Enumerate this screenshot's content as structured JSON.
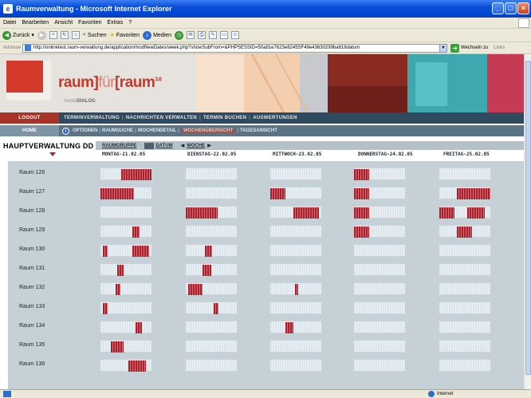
{
  "window": {
    "title": "Raumverwaltung - Microsoft Internet Explorer",
    "menu": [
      "Datei",
      "Bearbeiten",
      "Ansicht",
      "Favoriten",
      "Extras",
      "?"
    ],
    "toolbar": {
      "back": "Zurück",
      "search": "Suchen",
      "favorites": "Favoriten",
      "media": "Medien"
    },
    "address": {
      "label": "Adresse",
      "url": "http://onlinetest.raum-verwaltung.de/application/modNewDates/week.php?showSubFrom=&PHPSESSID=50a81e7623e8245SF49e43630299ba618datum",
      "go": "Wechseln zu",
      "links": "Links"
    },
    "status_zone": "Internet"
  },
  "brand": {
    "name_a": "raum]",
    "name_b": "für",
    "name_c": "[raum",
    "version": "3.6",
    "sub_a": "media",
    "sub_b": "DIALOG"
  },
  "nav1": {
    "logout": "LOGOUT",
    "items": [
      "TERMINVERWALTUNG",
      "NACHRICHTEN VERWALTEN",
      "TERMIN BUCHEN",
      "AUSWERTUNGEN"
    ]
  },
  "nav2": {
    "home": "HOME",
    "items": [
      "OPTIONEN",
      "RAUMSUCHE",
      "WOCHENDETAIL",
      "WOCHENÜBERSICHT",
      "TAGESANSICHT"
    ],
    "active_index": 3
  },
  "view": {
    "location": "HAUPTVERWALTUNG DD",
    "raumgruppe": "RAUMGRUPPE",
    "datum": "DATUM",
    "woche": "WOCHE",
    "days": [
      "MONTAG-21.02.05",
      "DIENSTAG-22.02.05",
      "MITTWOCH-23.02.05",
      "DONNERSTAG-24.02.05",
      "FREITAG-25.02.05"
    ]
  },
  "rooms": [
    {
      "name": "Raum 126",
      "bookings": [
        [
          [
            0.4,
            1.0
          ]
        ],
        [],
        [],
        [
          [
            0.0,
            0.3
          ]
        ],
        []
      ]
    },
    {
      "name": "Raum 127",
      "bookings": [
        [
          [
            0.0,
            0.65
          ]
        ],
        [],
        [
          [
            0.0,
            0.3
          ]
        ],
        [
          [
            0.0,
            0.3
          ]
        ],
        [
          [
            0.35,
            1.0
          ]
        ]
      ]
    },
    {
      "name": "Raum 128",
      "bookings": [
        [],
        [
          [
            0.0,
            0.63
          ]
        ],
        [
          [
            0.45,
            0.95
          ]
        ],
        [
          [
            0.0,
            0.3
          ]
        ],
        [
          [
            0.0,
            0.3
          ],
          [
            0.55,
            0.9
          ]
        ]
      ]
    },
    {
      "name": "Raum 129",
      "bookings": [
        [
          [
            0.62,
            0.76
          ]
        ],
        [],
        [],
        [
          [
            0.0,
            0.3
          ]
        ],
        [
          [
            0.35,
            0.65
          ]
        ]
      ]
    },
    {
      "name": "Raum 130",
      "bookings": [
        [
          [
            0.05,
            0.15
          ],
          [
            0.62,
            0.95
          ]
        ],
        [
          [
            0.38,
            0.52
          ]
        ],
        [],
        [],
        []
      ]
    },
    {
      "name": "Raum 131",
      "bookings": [
        [
          [
            0.33,
            0.45
          ]
        ],
        [
          [
            0.33,
            0.5
          ]
        ],
        [],
        [],
        []
      ]
    },
    {
      "name": "Raum 132",
      "bookings": [
        [
          [
            0.3,
            0.4
          ]
        ],
        [
          [
            0.05,
            0.33
          ]
        ],
        [
          [
            0.48,
            0.55
          ]
        ],
        [],
        []
      ]
    },
    {
      "name": "Raum 133",
      "bookings": [
        [
          [
            0.05,
            0.15
          ]
        ],
        [
          [
            0.55,
            0.65
          ]
        ],
        [],
        [],
        []
      ]
    },
    {
      "name": "Raum 134",
      "bookings": [
        [
          [
            0.68,
            0.8
          ]
        ],
        [],
        [
          [
            0.3,
            0.45
          ]
        ],
        [],
        []
      ]
    },
    {
      "name": "Raum 135",
      "bookings": [
        [
          [
            0.2,
            0.45
          ]
        ],
        [],
        [],
        [],
        []
      ]
    },
    {
      "name": "Raum 136",
      "bookings": [
        [
          [
            0.55,
            0.9
          ]
        ],
        [],
        [],
        [],
        []
      ]
    }
  ],
  "colors": {
    "booked": "#a8202a",
    "free": "#dde6ec",
    "logout": "#a93226",
    "navDark": "#2f4a5e",
    "navMid": "#5a7486",
    "brand": "#c5392b"
  }
}
